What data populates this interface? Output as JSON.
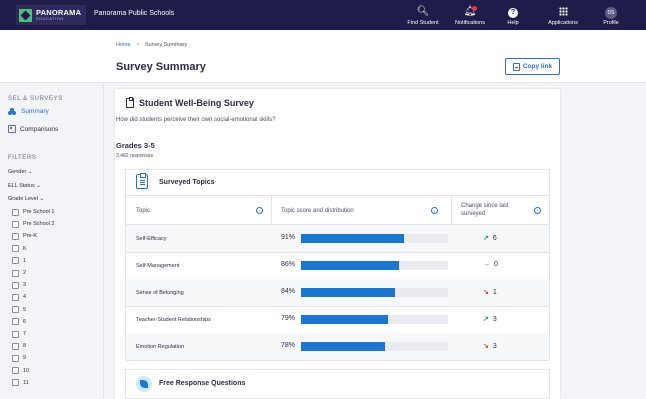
{
  "brand": {
    "logo_line1": "PANORAMA",
    "logo_line2": "EDUCATION",
    "school": "Panorama Public Schools"
  },
  "nav": [
    {
      "label": "Find Student",
      "icon": "search-icon"
    },
    {
      "label": "Notifications",
      "icon": "bell-icon"
    },
    {
      "label": "Help",
      "icon": "help-icon"
    },
    {
      "label": "Applications",
      "icon": "grid-icon"
    },
    {
      "label": "Profile",
      "icon": "avatar",
      "initials": "DS"
    }
  ],
  "breadcrumb": {
    "home": "Home",
    "separator": ">",
    "current": "Survey Summary"
  },
  "page_title": "Survey Summary",
  "copy_link": "Copy link",
  "sidebar": {
    "section_label": "SEL & SURVEYS",
    "summary": "Summary",
    "comparisons": "Comparisons",
    "filters_label": "FILTERS",
    "gender": "Gender",
    "ell_status": "ELL Status",
    "grade_level": "Grade Level",
    "grades": [
      "Pre School 1",
      "Pre School 2",
      "Pre-K",
      "K",
      "1",
      "2",
      "3",
      "4",
      "5",
      "6",
      "7",
      "8",
      "9",
      "10",
      "11"
    ]
  },
  "survey": {
    "title": "Student Well-Being Survey",
    "question": "How did students perceive their own social-emotional skills?",
    "grades": "Grades 3-5",
    "responses": "3,482 responses"
  },
  "topics": {
    "title": "Surveyed Topics",
    "headers": {
      "topic": "Topic",
      "score": "Topic score and distribution",
      "change": "Change since last surveyed"
    },
    "rows": [
      {
        "name": "Self-Efficacy",
        "pct": "91%",
        "fill": 0.7,
        "arrow": "↗",
        "change": "6",
        "arrow_color": "#2e9e6a"
      },
      {
        "name": "Self-Management",
        "pct": "86%",
        "fill": 0.67,
        "arrow": "→",
        "change": "0",
        "arrow_color": "#6a6d85"
      },
      {
        "name": "Sense of Belonging",
        "pct": "84%",
        "fill": 0.64,
        "arrow": "↘",
        "change": "1",
        "arrow_color": "#e0452b"
      },
      {
        "name": "Teacher-Student Relationships",
        "pct": "79%",
        "fill": 0.59,
        "arrow": "↗",
        "change": "3",
        "arrow_color": "#2e9e6a"
      },
      {
        "name": "Emotion Regulation",
        "pct": "78%",
        "fill": 0.57,
        "arrow": "↘",
        "change": "3",
        "arrow_color": "#e0452b"
      }
    ]
  },
  "frq_title": "Free Response Questions"
}
